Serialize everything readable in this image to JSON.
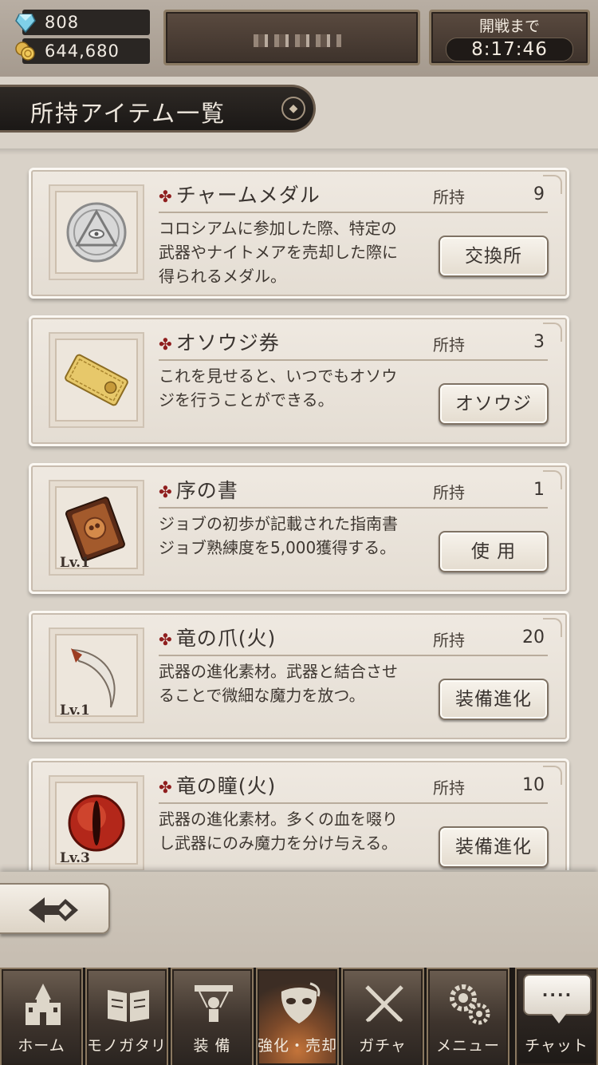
{
  "header": {
    "gems": "808",
    "gold": "644,680",
    "battle_label": "開戦まで",
    "battle_time": "8:17:46"
  },
  "section_title": "所持アイテム一覧",
  "own_label": "所持",
  "items": [
    {
      "name": "チャームメダル",
      "count": "9",
      "desc_lines": [
        "コロシアムに参加した際、特定の",
        "武器やナイトメアを売却した際に",
        "得られるメダル。"
      ],
      "button": "交換所",
      "level": "",
      "icon": "medal-icon"
    },
    {
      "name": "オソウジ券",
      "count": "3",
      "desc_lines": [
        "これを見せると、いつでもオソウ",
        "ジを行うことができる。",
        ""
      ],
      "button": "オソウジ",
      "level": "",
      "icon": "ticket-icon"
    },
    {
      "name": "序の書",
      "count": "1",
      "desc_lines": [
        "ジョブの初歩が記載された指南書",
        "ジョブ熟練度を5,000獲得する。",
        ""
      ],
      "button": "使 用",
      "level": "Lv.1",
      "icon": "book-icon"
    },
    {
      "name": "竜の爪(火)",
      "count": "20",
      "desc_lines": [
        "武器の進化素材。武器と結合させ",
        "ることで微細な魔力を放つ。",
        ""
      ],
      "button": "装備進化",
      "level": "Lv.1",
      "icon": "claw-icon"
    },
    {
      "name": "竜の瞳(火)",
      "count": "10",
      "desc_lines": [
        "武器の進化素材。多くの血を啜り",
        "し武器にのみ魔力を分け与える。",
        ""
      ],
      "button": "装備進化",
      "level": "Lv.3",
      "icon": "dragon-eye-icon"
    }
  ],
  "nav": {
    "tabs": [
      "ホーム",
      "モノガタリ",
      "装 備",
      "強化・売却",
      "ガチャ",
      "メニュー",
      "チャット"
    ],
    "active": "強化・売却",
    "chat_dots": "····"
  },
  "colors": {
    "accent_mark": "#8f1e1e",
    "panel_dark": "#2a2623",
    "card_bg": "#efe9e1"
  }
}
